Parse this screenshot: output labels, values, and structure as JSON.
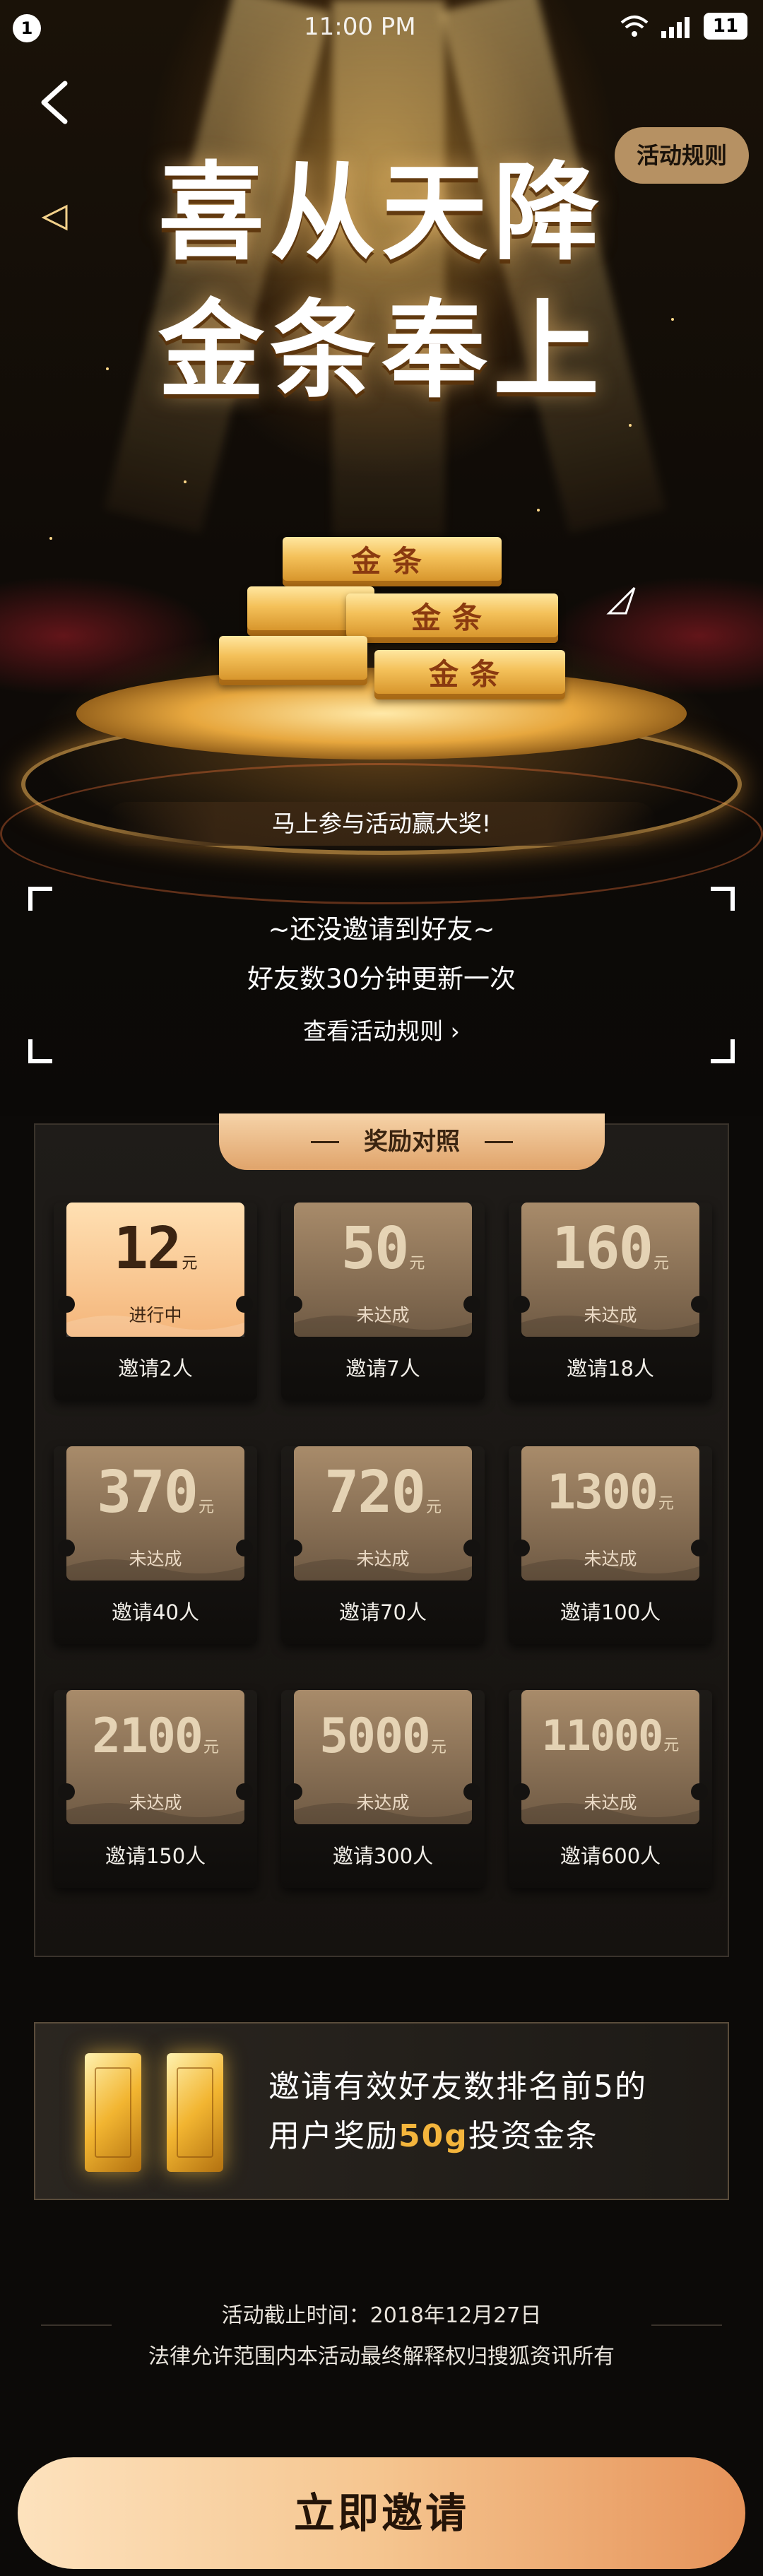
{
  "status_bar": {
    "badge": "1",
    "time": "11:00 PM",
    "battery": "11"
  },
  "hero": {
    "rules_button": "活动规则",
    "title_line1": "喜从天降",
    "title_line2": "金条奉上",
    "gold_bar_text": "金条",
    "join_tagline": "马上参与活动赢大奖!"
  },
  "invite_box": {
    "line1": "~还没邀请到好友~",
    "line2": "好友数30分钟更新一次",
    "link": "查看活动规则 ›"
  },
  "rewards": {
    "header": "奖励对照",
    "unit": "元",
    "items": [
      {
        "amount": "12",
        "status": "进行中",
        "label": "邀请2人",
        "active": true
      },
      {
        "amount": "50",
        "status": "未达成",
        "label": "邀请7人",
        "active": false
      },
      {
        "amount": "160",
        "status": "未达成",
        "label": "邀请18人",
        "active": false
      },
      {
        "amount": "370",
        "status": "未达成",
        "label": "邀请40人",
        "active": false
      },
      {
        "amount": "720",
        "status": "未达成",
        "label": "邀请70人",
        "active": false
      },
      {
        "amount": "1300",
        "status": "未达成",
        "label": "邀请100人",
        "active": false
      },
      {
        "amount": "2100",
        "status": "未达成",
        "label": "邀请150人",
        "active": false
      },
      {
        "amount": "5000",
        "status": "未达成",
        "label": "邀请300人",
        "active": false
      },
      {
        "amount": "11000",
        "status": "未达成",
        "label": "邀请600人",
        "active": false
      }
    ]
  },
  "ranking": {
    "line1": "邀请有效好友数排名前5的",
    "line2_prefix": "用户奖励",
    "line2_highlight": "50g",
    "line2_suffix": "投资金条"
  },
  "footer": {
    "deadline": "活动截止时间：2018年12月27日",
    "legal": "法律允许范围内本活动最终解释权归搜狐资讯所有"
  },
  "cta": {
    "label": "立即邀请"
  },
  "colors": {
    "accent_gold": "#f4b53c",
    "cta_start": "#fde2bd",
    "cta_end": "#e6935a"
  }
}
